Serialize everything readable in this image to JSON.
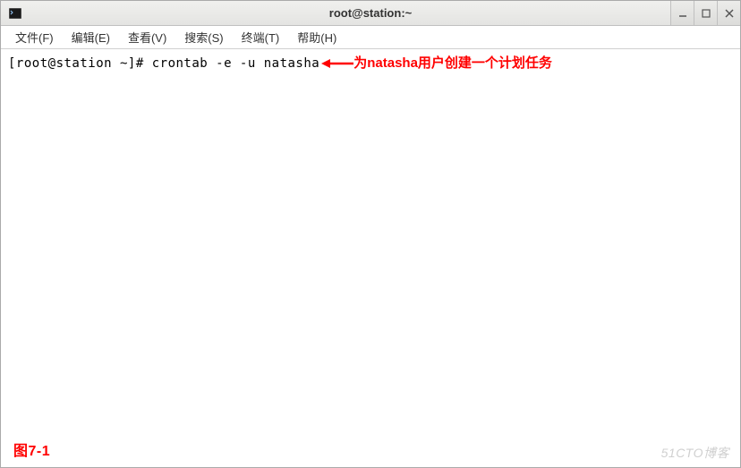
{
  "window": {
    "title": "root@station:~"
  },
  "menubar": {
    "items": [
      "文件(F)",
      "编辑(E)",
      "查看(V)",
      "搜索(S)",
      "终端(T)",
      "帮助(H)"
    ]
  },
  "terminal": {
    "prompt": "[root@station ~]# ",
    "command": "crontab -e -u natasha"
  },
  "annotation": {
    "text": "为natasha用户创建一个计划任务"
  },
  "figure_label": "图7-1",
  "watermark": "51CTO博客"
}
